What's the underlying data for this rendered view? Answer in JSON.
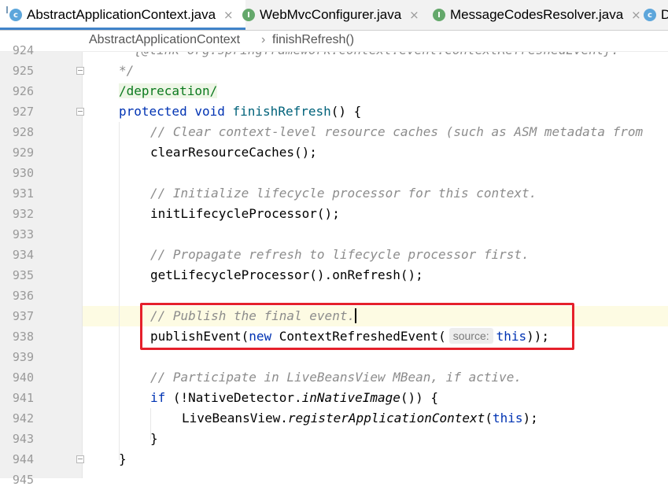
{
  "tabs": [
    {
      "label": "AbstractApplicationContext.java",
      "icon": "class-icon",
      "close": "×",
      "active": true
    },
    {
      "label": "WebMvcConfigurer.java",
      "icon": "interface-icon",
      "close": "×",
      "active": false
    },
    {
      "label": "MessageCodesResolver.java",
      "icon": "interface-icon",
      "close": "×",
      "active": false
    },
    {
      "label": "D",
      "icon": "class-icon",
      "active": false
    }
  ],
  "breadcrumb": {
    "class_name": "AbstractApplicationContext",
    "separator": "›",
    "method_name": "finishRefresh()"
  },
  "line_numbers": [
    "924",
    "925",
    "926",
    "927",
    "928",
    "929",
    "930",
    "931",
    "932",
    "933",
    "934",
    "935",
    "936",
    "937",
    "938",
    "939",
    "940",
    "941",
    "942",
    "943",
    "944",
    "945"
  ],
  "code": {
    "l924": "* {@link org.springframework.context.event.ContextRefreshedEvent}.",
    "l925": "*/",
    "l926": "/deprecation/",
    "l927_kw1": "protected",
    "l927_kw2": "void",
    "l927_name": "finishRefresh",
    "l927_rest": "() {",
    "l928": "// Clear context-level resource caches (such as ASM metadata from",
    "l929": "clearResourceCaches();",
    "l931": "// Initialize lifecycle processor for this context.",
    "l932": "initLifecycleProcessor();",
    "l934": "// Propagate refresh to lifecycle processor first.",
    "l935": "getLifecycleProcessor().onRefresh();",
    "l937": "// Publish the final event.",
    "l938_a": "publishEvent(",
    "l938_new": "new",
    "l938_b": " ContextRefreshedEvent(",
    "l938_hint": "source:",
    "l938_this": "this",
    "l938_c": "));",
    "l940": "// Participate in LiveBeansView MBean, if active.",
    "l941_if": "if",
    "l941_a": " (!NativeDetector.",
    "l941_m": "inNativeImage",
    "l941_b": "()) {",
    "l942_a": "LiveBeansView.",
    "l942_m": "registerApplicationContext",
    "l942_b": "(",
    "l942_this": "this",
    "l942_c": ");",
    "l943": "}",
    "l944": "}"
  },
  "colors": {
    "keyword": "#0033b3",
    "comment": "#8c8c8c",
    "method": "#00627a",
    "highlight_box": "#e5202b",
    "current_line": "#fdfbe3"
  }
}
